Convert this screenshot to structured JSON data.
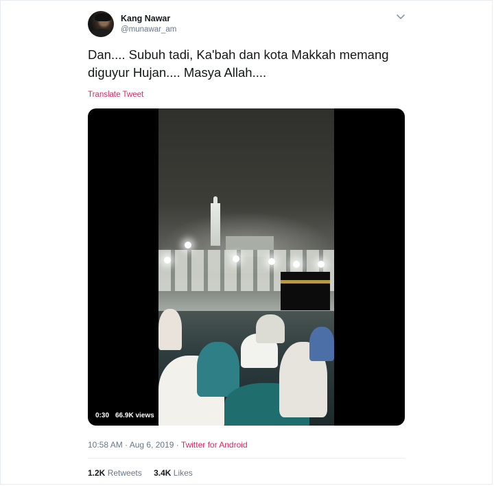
{
  "author": {
    "name": "Kang Nawar",
    "handle": "@munawar_am"
  },
  "menu_icon": "chevron-down-icon",
  "tweet": {
    "text": "Dan.... Subuh tadi, Ka'bah dan kota Makkah memang\ndiguyur Hujan.... Masya Allah....",
    "translate_label": "Translate Tweet"
  },
  "media": {
    "duration": "0:30",
    "views": "66.9K views"
  },
  "meta": {
    "time": "10:58 AM",
    "separator": " · ",
    "date": "Aug 6, 2019",
    "separator2": " · ",
    "source": "Twitter for Android"
  },
  "stats": {
    "retweets_count": "1.2K",
    "retweets_label": "Retweets",
    "likes_count": "3.4K",
    "likes_label": "Likes"
  },
  "colors": {
    "accent": "#e0245e",
    "secondary_text": "#657786",
    "primary_text": "#14171a",
    "border": "#e6ecf0"
  }
}
